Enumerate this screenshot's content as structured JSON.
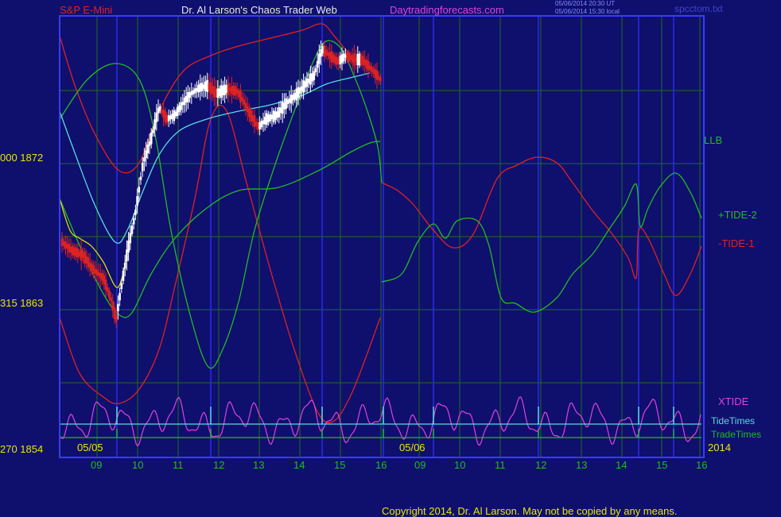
{
  "header": {
    "instrument": "S&P E-Mini",
    "site": "Dr. Al Larson's Chaos Trader Web",
    "url": "Daytradingforecasts.com",
    "timestamp_utc": "05/06/2014 20:30 UT",
    "timestamp_local": "05/06/2014 15:30 local",
    "file": "spcctom.txt"
  },
  "labels": {
    "llb": "LLB",
    "tide2": "+TIDE-2",
    "tide1": "-TIDE-1",
    "xtide": "XTIDE",
    "tidetimes": "TideTimes",
    "tradetimes": "TradeTimes",
    "year": "2014",
    "copyright": "Copyright 2014, Dr. Al Larson. May not be copied by any means."
  },
  "colors": {
    "background": "#0f0f6e",
    "plot_border": "#3a3aff",
    "grid": "#1f6e1f",
    "header_red": "#dd2222",
    "header_white": "#e8e8e8",
    "magenta": "#dd44dd",
    "green": "#22bb22",
    "red": "#dd2222",
    "cyan": "#55dddd",
    "white": "#ffffff",
    "yellow": "#e8e800"
  },
  "chart_data": {
    "type": "line",
    "title": "S&P E-Mini",
    "x_labels": [
      "09",
      "10",
      "11",
      "12",
      "13",
      "14",
      "15",
      "16",
      "09",
      "10",
      "11",
      "12",
      "13",
      "14",
      "15",
      "16"
    ],
    "date_labels": [
      "05/05",
      "05/06"
    ],
    "y_labels": [
      {
        "value": 1872,
        "text": "000  1872"
      },
      {
        "value": 1863,
        "text": "315  1863"
      },
      {
        "value": 1854,
        "text": "270  1854"
      }
    ],
    "ylim": [
      1854,
      1872
    ],
    "series": [
      {
        "name": "LLB"
      },
      {
        "name": "+TIDE-2"
      },
      {
        "name": "-TIDE-1"
      },
      {
        "name": "XTIDE"
      },
      {
        "name": "TideTimes"
      },
      {
        "name": "TradeTimes"
      }
    ]
  }
}
